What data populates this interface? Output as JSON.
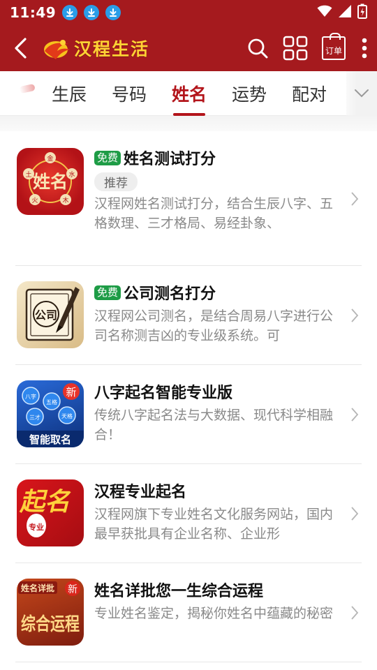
{
  "status_bar": {
    "time": "11:49",
    "download_icons": [
      "download-icon",
      "download-icon",
      "download-icon"
    ],
    "indicators": [
      "wifi-icon",
      "signal-icon",
      "battery-icon"
    ]
  },
  "app_bar": {
    "logo_text": "汉程生活",
    "order_label": "订单",
    "colors": {
      "bar": "#a51a1e",
      "logo_text": "#ffd234"
    }
  },
  "tabs": {
    "items": [
      {
        "label": "生辰",
        "active": false
      },
      {
        "label": "号码",
        "active": false
      },
      {
        "label": "姓名",
        "active": true
      },
      {
        "label": "运势",
        "active": false
      },
      {
        "label": "配对",
        "active": false
      }
    ],
    "active_color": "#b3151b"
  },
  "list": {
    "items": [
      {
        "badge": "免费",
        "title": "姓名测试打分",
        "tag": "推荐",
        "desc": "汉程网姓名测试打分，结合生辰八字、五格数理、三才格局、易经卦象、",
        "icon": "name-test-app-icon",
        "icon_text": "姓名",
        "icon_ring": [
          "金",
          "水",
          "木",
          "火",
          "土"
        ]
      },
      {
        "badge": "免费",
        "title": "公司测名打分",
        "desc": "汉程网公司测名，是结合周易八字进行公司名称测吉凶的专业级系统。可",
        "icon": "company-name-app-icon",
        "icon_text": "公司"
      },
      {
        "title": "八字起名智能专业版",
        "desc": "传统八字起名法与大数据、现代科学相融合！",
        "icon": "bazi-naming-app-icon",
        "icon_text": "智能取名",
        "icon_badge": "新",
        "icon_bubbles": [
          "八字",
          "五格",
          "三才",
          "天格"
        ]
      },
      {
        "title": "汉程专业起名",
        "desc": "汉程网旗下专业姓名文化服务网站，国内最早获批具有企业名称、企业形",
        "icon": "pro-naming-app-icon",
        "icon_text_main": "起名",
        "icon_text_sub": "专业"
      },
      {
        "title": "姓名详批您一生综合运程",
        "desc": "专业姓名鉴定，揭秘你姓名中蕴藏的秘密",
        "icon": "name-detail-app-icon",
        "icon_label": "姓名详批",
        "icon_badge": "新",
        "icon_text": "综合运程"
      }
    ],
    "free_badge_color": "#1e9c46"
  }
}
